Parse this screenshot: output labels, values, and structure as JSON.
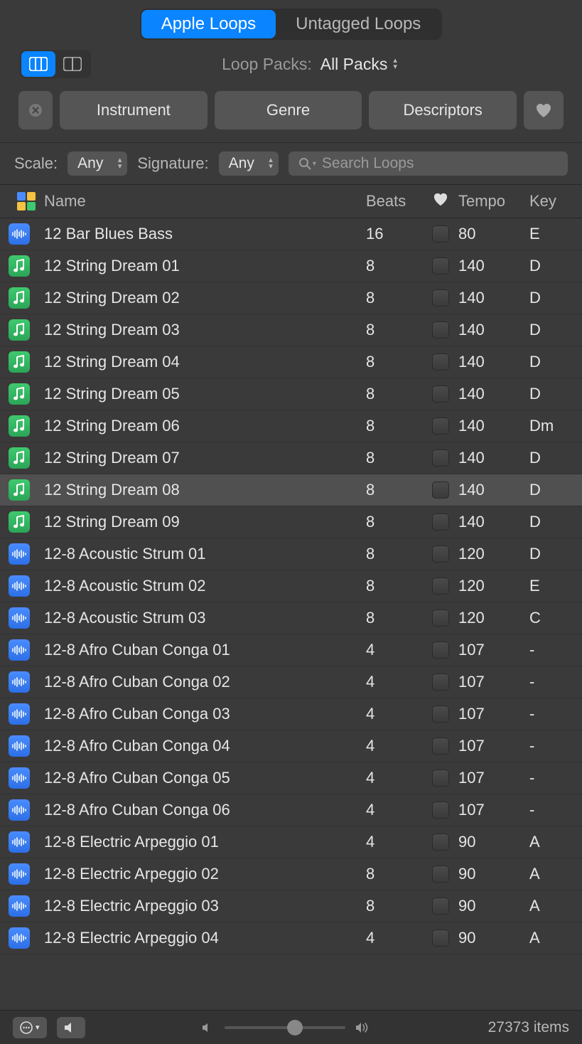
{
  "tabs": {
    "apple": "Apple Loops",
    "untagged": "Untagged Loops"
  },
  "packs": {
    "label": "Loop Packs:",
    "value": "All Packs"
  },
  "filters": {
    "instrument": "Instrument",
    "genre": "Genre",
    "descriptors": "Descriptors"
  },
  "search_row": {
    "scale_label": "Scale:",
    "scale_value": "Any",
    "signature_label": "Signature:",
    "signature_value": "Any",
    "search_placeholder": "Search Loops"
  },
  "headers": {
    "name": "Name",
    "beats": "Beats",
    "tempo": "Tempo",
    "key": "Key"
  },
  "rows": [
    {
      "type": "audio",
      "name": "12 Bar Blues Bass",
      "beats": "16",
      "tempo": "80",
      "key": "E"
    },
    {
      "type": "midi",
      "name": "12 String Dream 01",
      "beats": "8",
      "tempo": "140",
      "key": "D"
    },
    {
      "type": "midi",
      "name": "12 String Dream 02",
      "beats": "8",
      "tempo": "140",
      "key": "D"
    },
    {
      "type": "midi",
      "name": "12 String Dream 03",
      "beats": "8",
      "tempo": "140",
      "key": "D"
    },
    {
      "type": "midi",
      "name": "12 String Dream 04",
      "beats": "8",
      "tempo": "140",
      "key": "D"
    },
    {
      "type": "midi",
      "name": "12 String Dream 05",
      "beats": "8",
      "tempo": "140",
      "key": "D"
    },
    {
      "type": "midi",
      "name": "12 String Dream 06",
      "beats": "8",
      "tempo": "140",
      "key": "Dm"
    },
    {
      "type": "midi",
      "name": "12 String Dream 07",
      "beats": "8",
      "tempo": "140",
      "key": "D"
    },
    {
      "type": "midi",
      "name": "12 String Dream 08",
      "beats": "8",
      "tempo": "140",
      "key": "D",
      "selected": true
    },
    {
      "type": "midi",
      "name": "12 String Dream 09",
      "beats": "8",
      "tempo": "140",
      "key": "D"
    },
    {
      "type": "audio",
      "name": "12-8 Acoustic Strum 01",
      "beats": "8",
      "tempo": "120",
      "key": "D"
    },
    {
      "type": "audio",
      "name": "12-8 Acoustic Strum 02",
      "beats": "8",
      "tempo": "120",
      "key": "E"
    },
    {
      "type": "audio",
      "name": "12-8 Acoustic Strum 03",
      "beats": "8",
      "tempo": "120",
      "key": "C"
    },
    {
      "type": "audio",
      "name": "12-8 Afro Cuban Conga 01",
      "beats": "4",
      "tempo": "107",
      "key": "-"
    },
    {
      "type": "audio",
      "name": "12-8 Afro Cuban Conga 02",
      "beats": "4",
      "tempo": "107",
      "key": "-"
    },
    {
      "type": "audio",
      "name": "12-8 Afro Cuban Conga 03",
      "beats": "4",
      "tempo": "107",
      "key": "-"
    },
    {
      "type": "audio",
      "name": "12-8 Afro Cuban Conga 04",
      "beats": "4",
      "tempo": "107",
      "key": "-"
    },
    {
      "type": "audio",
      "name": "12-8 Afro Cuban Conga 05",
      "beats": "4",
      "tempo": "107",
      "key": "-"
    },
    {
      "type": "audio",
      "name": "12-8 Afro Cuban Conga 06",
      "beats": "4",
      "tempo": "107",
      "key": "-"
    },
    {
      "type": "audio",
      "name": "12-8 Electric Arpeggio 01",
      "beats": "4",
      "tempo": "90",
      "key": "A"
    },
    {
      "type": "audio",
      "name": "12-8 Electric Arpeggio 02",
      "beats": "8",
      "tempo": "90",
      "key": "A"
    },
    {
      "type": "audio",
      "name": "12-8 Electric Arpeggio 03",
      "beats": "8",
      "tempo": "90",
      "key": "A"
    },
    {
      "type": "audio",
      "name": "12-8 Electric Arpeggio 04",
      "beats": "4",
      "tempo": "90",
      "key": "A"
    }
  ],
  "footer": {
    "item_count": "27373 items"
  }
}
